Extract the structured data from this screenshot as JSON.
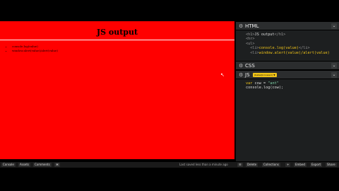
{
  "preview": {
    "heading": "JS output",
    "items": [
      "console.log(value)",
      "window.alert(value)/alert(value)"
    ]
  },
  "html_panel": {
    "title": "HTML",
    "lines": [
      {
        "pre": "<h1>",
        "mid": "JS output",
        "post": "</h1>"
      },
      {
        "pre": "<hr>",
        "mid": "",
        "post": ""
      },
      {
        "pre": "<ul>",
        "mid": "",
        "post": ""
      },
      {
        "pre": "  <li>",
        "mid": "console.log(value)",
        "post": "</li>"
      },
      {
        "pre": "  <li>",
        "mid": "window.alert(value)/alert(value)",
        "post": ""
      }
    ]
  },
  "css_panel": {
    "title": "CSS"
  },
  "js_panel": {
    "title": "JS",
    "badge": "(babel/processor) ▼",
    "lines": [
      {
        "kw": "var",
        "rest": " cow = ",
        "str": "\"ant\""
      },
      {
        "kw": "",
        "rest": "console.log(cow);",
        "str": ""
      }
    ]
  },
  "bottom_bar": {
    "left_buttons": [
      "Console",
      "Assets",
      "Comments",
      "⌘"
    ],
    "saved_text": "Last saved less than a minute ago",
    "right_buttons": [
      "☰",
      "Delete",
      "Collections",
      "+",
      "Embed",
      "Export",
      "Share"
    ]
  },
  "colors": {
    "preview_bg": "#ff0000",
    "editor_bg": "#1d1f20",
    "accent": "#f0c419"
  }
}
